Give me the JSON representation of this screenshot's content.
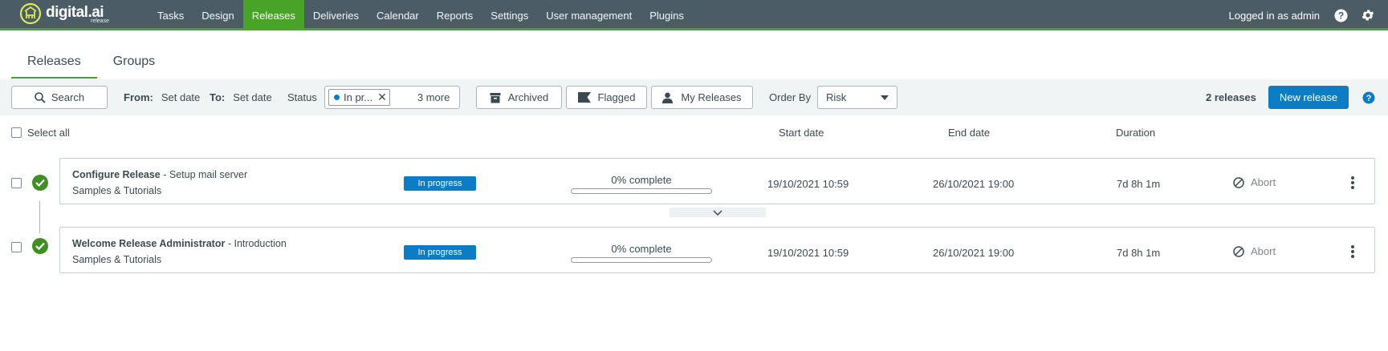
{
  "colors": {
    "nav_bg": "#4b5c66",
    "accent_green": "#4aa329",
    "primary_blue": "#0c7dc4"
  },
  "brand": {
    "name": "digital.ai",
    "sub": "release"
  },
  "nav": {
    "items": [
      "Tasks",
      "Design",
      "Releases",
      "Deliveries",
      "Calendar",
      "Reports",
      "Settings",
      "User management",
      "Plugins"
    ],
    "active": "Releases",
    "user_text": "Logged in as admin",
    "icons": [
      "help-icon",
      "gear-icon"
    ]
  },
  "tabs": {
    "releases": "Releases",
    "groups": "Groups",
    "active": "Releases"
  },
  "filters": {
    "search_label": "Search",
    "from_label": "From:",
    "from_value": "Set date",
    "to_label": "To:",
    "to_value": "Set date",
    "status_label": "Status",
    "status_chip": "In pr...",
    "status_more": "3 more",
    "archived": "Archived",
    "flagged": "Flagged",
    "my_releases": "My Releases",
    "order_by_label": "Order By",
    "order_by_value": "Risk",
    "count_text": "2 releases",
    "new_release": "New release"
  },
  "table": {
    "select_all": "Select all",
    "columns": {
      "start": "Start date",
      "end": "End date",
      "duration": "Duration"
    }
  },
  "releases": [
    {
      "name": "Configure Release",
      "description": "Setup mail server",
      "folder": "Samples & Tutorials",
      "status": "In progress",
      "progress_text": "0% complete",
      "progress_pct": 0,
      "start": "19/10/2021 10:59",
      "end": "26/10/2021 19:00",
      "duration": "7d 8h 1m",
      "action": "Abort"
    },
    {
      "name": "Welcome Release Administrator",
      "description": "Introduction",
      "folder": "Samples & Tutorials",
      "status": "In progress",
      "progress_text": "0% complete",
      "progress_pct": 0,
      "start": "19/10/2021 10:59",
      "end": "26/10/2021 19:00",
      "duration": "7d 8h 1m",
      "action": "Abort"
    }
  ],
  "separator": " - "
}
